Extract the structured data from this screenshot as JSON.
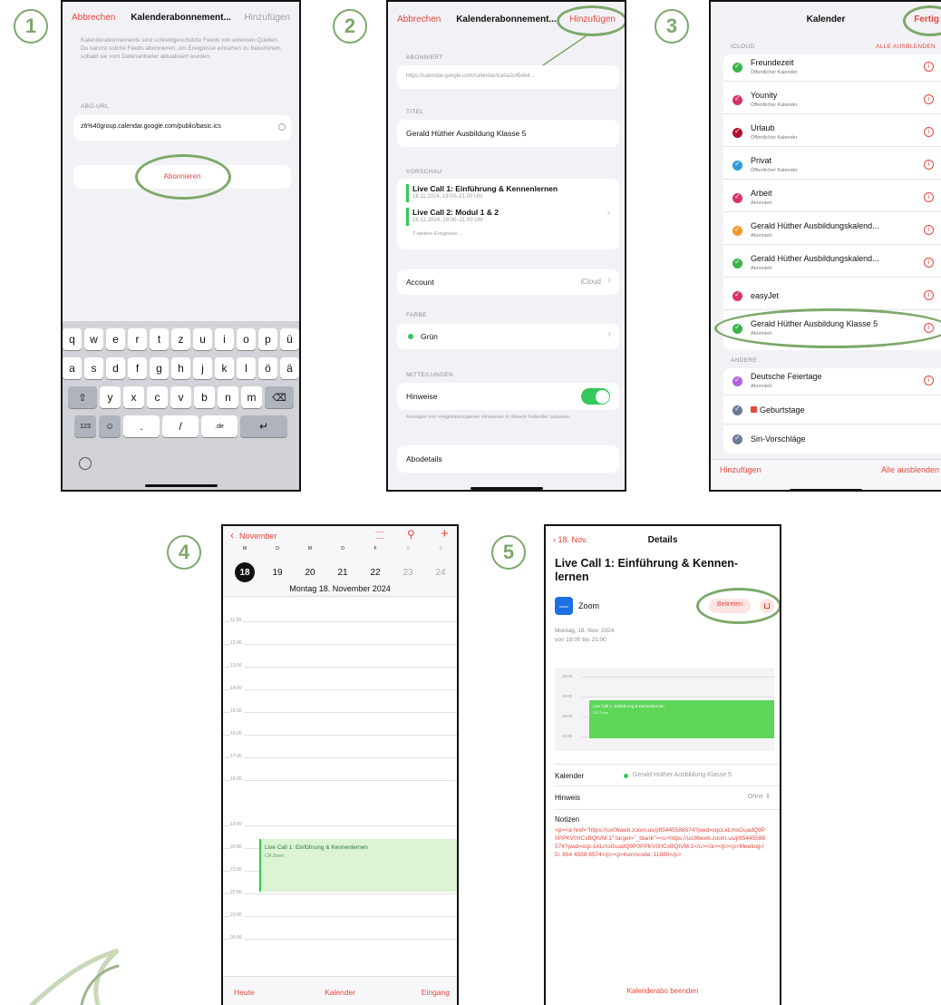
{
  "steps": [
    "1",
    "2",
    "3",
    "4",
    "5"
  ],
  "s1": {
    "cancel": "Abbrechen",
    "title": "Kalenderabonnement...",
    "add": "Hinzufügen",
    "info": "Kalenderabonnements sind schreibgeschützte Feeds von externen Quellen. Du kannst solche Feeds abonnieren, um Ereignisse einsehen zu bekommen, sobald sie vom Datenanbieter aktualisiert wurden.",
    "url_label": "ABO-URL",
    "url_value": "z6%40group.calendar.google.com/public/basic.ics",
    "subscribe": "Abonnieren",
    "keys_row1": [
      "q",
      "w",
      "e",
      "r",
      "t",
      "z",
      "u",
      "i",
      "o",
      "p",
      "ü"
    ],
    "keys_row2": [
      "a",
      "s",
      "d",
      "f",
      "g",
      "h",
      "j",
      "k",
      "l",
      "ö",
      "ä"
    ],
    "keys_row3": [
      "y",
      "x",
      "c",
      "v",
      "b",
      "n",
      "m"
    ],
    "key_123": "123",
    "key_dot": ".",
    "key_slash": "/",
    "key_de": ".de"
  },
  "s2": {
    "cancel": "Abbrechen",
    "title": "Kalenderabonnement...",
    "add": "Hinzufügen",
    "subscribed_label": "ABONNIERT",
    "url": "https://calendar.google.com/calendar/ical/a2c45eb4...",
    "title_label": "TITEL",
    "title_value": "Gerald Hüther Ausbildung Klasse 5",
    "preview_label": "VORSCHAU",
    "events": [
      {
        "name": "Live Call 1: Einführung & Kennenlernen",
        "time": "18.11.2024, 19:00–21:00 Uhr"
      },
      {
        "name": "Live Call 2: Modul 1 & 2",
        "time": "16.12.2024, 19:00–21:00 Uhr"
      }
    ],
    "more": "7 weitere Ereignisse ...",
    "account_label": "Account",
    "account_value": "iCloud",
    "color_label": "FARBE",
    "color_value": "Grün",
    "notifications_label": "MITTEILUNGEN",
    "alerts": "Hinweise",
    "alerts_note": "Anzeigen von ereignisbezogenen Hinweisen in diesem Kalender zulassen.",
    "details": "Abodetails"
  },
  "s3": {
    "title": "Kalender",
    "done": "Fertig",
    "icloud": "ICLOUD",
    "hide_all_top": "ALLE AUSBLENDEN",
    "calendars": [
      {
        "name": "Freundezeit",
        "sub": "Öffentlicher Kalender",
        "color": "#3ab44a"
      },
      {
        "name": "Younity",
        "sub": "Öffentlicher Kalender",
        "color": "#d6336c"
      },
      {
        "name": "Urlaub",
        "sub": "Öffentlicher Kalender",
        "color": "#b0102a"
      },
      {
        "name": "Privat",
        "sub": "Öffentlicher Kalender",
        "color": "#2d9cdb"
      },
      {
        "name": "Arbeit",
        "sub": "Abonniert",
        "color": "#d6336c"
      },
      {
        "name": "Gerald Hüther Ausbildungskalend...",
        "sub": "Abonniert",
        "color": "#f2992e"
      },
      {
        "name": "Gerald Hüther Ausbildungskalend...",
        "sub": "Abonniert",
        "color": "#3ab44a"
      },
      {
        "name": "easyJet",
        "sub": "",
        "color": "#d6336c"
      },
      {
        "name": "Gerald Hüther Ausbildung Klasse 5",
        "sub": "Abonniert",
        "color": "#3ab44a"
      }
    ],
    "other": "ANDERE",
    "others": [
      {
        "name": "Deutsche Feiertage",
        "sub": "Abonniert",
        "color": "#b15fe0"
      },
      {
        "name": "Geburtstage",
        "sub": "",
        "color": "#6b7a99"
      },
      {
        "name": "Siri-Vorschläge",
        "sub": "",
        "color": "#6b7a99"
      }
    ],
    "add": "Hinzufügen",
    "hide_all": "Alle ausblenden"
  },
  "s4": {
    "back": "November",
    "weekdays": [
      "M",
      "D",
      "M",
      "D",
      "F",
      "S",
      "S"
    ],
    "days": [
      "18",
      "19",
      "20",
      "21",
      "22",
      "23",
      "24"
    ],
    "date_title": "Montag  18. November 2024",
    "hours": [
      "11:00",
      "12:00",
      "13:00",
      "14:00",
      "15:00",
      "16:00",
      "17:00",
      "18:00",
      "19:00",
      "20:00",
      "21:00",
      "22:00",
      "23:00",
      "00:00"
    ],
    "event_title": "Live Call 1: Einführung & Kennenlernen",
    "event_loc": "CR Zoom",
    "today": "Heute",
    "calendars": "Kalender",
    "inbox": "Eingang"
  },
  "s5": {
    "back": "18. Nov.",
    "title": "Details",
    "event_title": "Live Call 1: Einführung & Kennen-lernen",
    "app_icon": "zoom",
    "app": "Zoom",
    "join": "Beitreten",
    "date": "Montag, 18. Nov. 2024",
    "time": "von 19:00 bis 21:00",
    "mini_hours": [
      "18:00",
      "19:00",
      "20:00",
      "21:00"
    ],
    "mini_event": "Live Call 1: Einführung & Kennenlernen",
    "mini_loc": "CR Zoom",
    "calendar_label": "Kalender",
    "calendar_value": "Gerald Hüther Ausbildung Klasse 5",
    "alert_label": "Hinweis",
    "alert_value": "Ohne",
    "notes_label": "Notizen",
    "notes_text": "<p><a href=\"https://us06web.zoom.us/j/85445588574?pwd=xqcLkLmsGuadQ9P0PPKV0rICxBQtVM.1\" target=\"_blank\"><u>https://us06web.zoom.us/j/85445588574?pwd=xqc-LkLmsGuadQ9P0PPKV0rICxBQtVM.1</u></a></p><p>Meeting-ID: 854 4558 8574</p><p>Kenncode: 11880</p>",
    "end": "Kalenderabo beenden"
  },
  "colors": {
    "accent": "#e8473d",
    "green": "#7da86a",
    "ios_green": "#34c759"
  }
}
